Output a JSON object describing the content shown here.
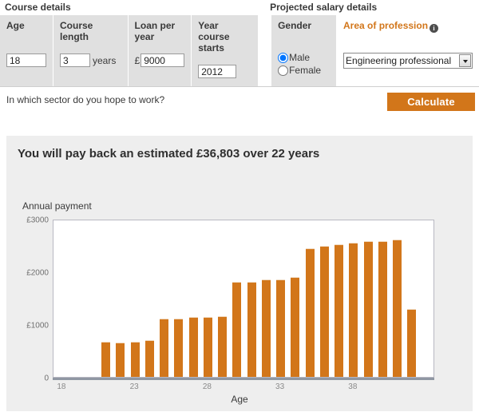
{
  "form": {
    "group_titles": {
      "course": "Course details",
      "salary": "Projected salary details"
    },
    "fields": {
      "age": {
        "label": "Age",
        "value": "18"
      },
      "course_length": {
        "label": "Course length",
        "value": "3",
        "suffix": "years"
      },
      "loan_per_year": {
        "label": "Loan per year",
        "prefix": "£",
        "value": "9000"
      },
      "year_course_starts": {
        "label": "Year course starts",
        "value": "2012"
      },
      "gender": {
        "label": "Gender",
        "options": [
          "Male",
          "Female"
        ],
        "selected": "Male"
      },
      "area_of_profession": {
        "label": "Area of profession",
        "info_glyph": "i",
        "selected": "Engineering professional",
        "options": [
          "Engineering professional"
        ]
      }
    },
    "sector_question": "In which sector do you hope to work?",
    "calculate_label": "Calculate"
  },
  "results": {
    "headline": "You will pay back an estimated £36,803 over 22 years"
  },
  "chart_data": {
    "type": "bar",
    "title": "Annual payment",
    "xlabel": "Age",
    "ylabel": "Annual payment",
    "ylim": [
      0,
      3000
    ],
    "yticks": [
      0,
      1000,
      2000,
      3000
    ],
    "ytick_labels": [
      "0",
      "£1000",
      "£2000",
      "£3000"
    ],
    "xticks": [
      18,
      23,
      28,
      33,
      38
    ],
    "xlim": [
      17.4,
      43.6
    ],
    "grid": false,
    "legend": false,
    "bar_color": "#d2761a",
    "categories": [
      21,
      22,
      23,
      24,
      25,
      26,
      27,
      28,
      29,
      30,
      31,
      32,
      33,
      34,
      35,
      36,
      37,
      38,
      39,
      40,
      41,
      42
    ],
    "values": [
      660,
      655,
      665,
      690,
      1110,
      1105,
      1130,
      1130,
      1155,
      1800,
      1810,
      1845,
      1850,
      1890,
      2440,
      2480,
      2520,
      2545,
      2570,
      2580,
      2600,
      1290
    ]
  }
}
